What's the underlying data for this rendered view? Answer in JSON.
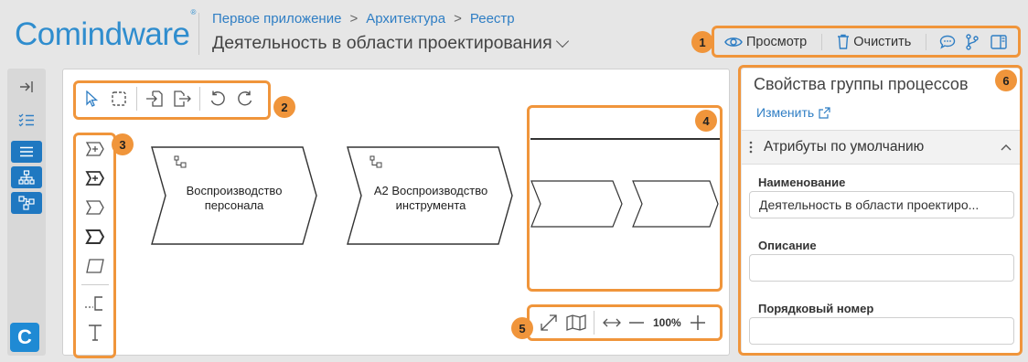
{
  "header": {
    "logo": "Comindware",
    "logo_mark": "®",
    "breadcrumb": [
      "Первое приложение",
      "Архитектура",
      "Реестр"
    ],
    "breadcrumb_sep": ">",
    "title": "Деятельность в области проектирования"
  },
  "toolbar": {
    "view_label": "Просмотр",
    "clear_label": "Очистить",
    "icons": [
      "eye-icon",
      "trash-icon",
      "comment-icon",
      "branch-icon",
      "panel-icon"
    ]
  },
  "rail": {
    "icons": [
      "expand-icon",
      "checklist-icon",
      "list-icon",
      "hierarchy-icon",
      "diagram-icon"
    ],
    "logo_letter": "C"
  },
  "canvas": {
    "tools": [
      "pointer-icon",
      "select-area-icon",
      "import-icon",
      "export-icon",
      "undo-icon",
      "redo-icon"
    ],
    "palette": [
      "process-group-plus-icon",
      "process-plus-icon",
      "process-chevron-icon",
      "process-chevron-bold-icon",
      "parallelogram-icon",
      "connector-icon",
      "text-tool-icon"
    ],
    "shapes": [
      {
        "label_line1": "Воспроизводство",
        "label_line2": "персонала"
      },
      {
        "label_line1": "А2 Воспроизводство",
        "label_line2": "инструмента"
      }
    ],
    "zoom": {
      "value": "100%"
    }
  },
  "markers": [
    "1",
    "2",
    "3",
    "4",
    "5",
    "6"
  ],
  "panel": {
    "title": "Свойства группы процессов",
    "edit_link": "Изменить",
    "section": "Атрибуты по умолчанию",
    "fields": [
      {
        "label": "Наименование",
        "value": "Деятельность в области проектиро..."
      },
      {
        "label": "Описание",
        "value": ""
      },
      {
        "label": "Порядковый номер",
        "value": ""
      }
    ]
  },
  "colors": {
    "accent": "#f0953b",
    "brand": "#2f8dce",
    "rail_active": "#1f78c1"
  }
}
